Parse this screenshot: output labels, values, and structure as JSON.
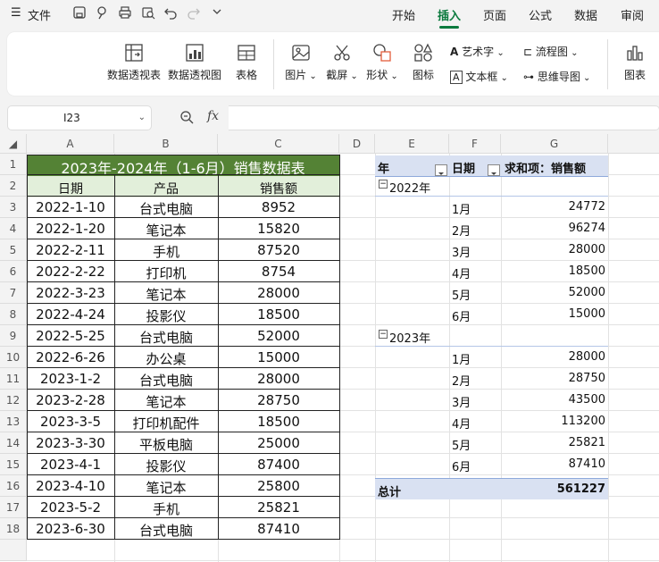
{
  "menubar": {
    "menu_icon": "☰",
    "file_label": "文件",
    "tabs": [
      "开始",
      "插入",
      "页面",
      "公式",
      "数据",
      "审阅"
    ],
    "active_tab": "插入"
  },
  "ribbon": {
    "pivot_table": "数据透视表",
    "pivot_chart": "数据透视图",
    "table": "表格",
    "picture": "图片",
    "screenshot": "截屏",
    "shape": "形状",
    "icon": "图标",
    "wordart": "艺术字",
    "textbox": "文本框",
    "flowchart": "流程图",
    "mindmap": "思维导图",
    "chart": "图表"
  },
  "formula": {
    "namebox": "I23",
    "fx": "fx",
    "value": ""
  },
  "columns": [
    "A",
    "B",
    "C",
    "D",
    "E",
    "F",
    "G"
  ],
  "rows": [
    "1",
    "2",
    "3",
    "4",
    "5",
    "6",
    "7",
    "8",
    "9",
    "10",
    "11",
    "12",
    "13",
    "14",
    "15",
    "16",
    "17",
    "18",
    ""
  ],
  "table": {
    "title": "2023年-2024年（1-6月）销售数据表",
    "headers": [
      "日期",
      "产品",
      "销售额"
    ],
    "rows": [
      [
        "2022-1-10",
        "台式电脑",
        "8952"
      ],
      [
        "2022-1-20",
        "笔记本",
        "15820"
      ],
      [
        "2022-2-11",
        "手机",
        "87520"
      ],
      [
        "2022-2-22",
        "打印机",
        "8754"
      ],
      [
        "2022-3-23",
        "笔记本",
        "28000"
      ],
      [
        "2022-4-24",
        "投影仪",
        "18500"
      ],
      [
        "2022-5-25",
        "台式电脑",
        "52000"
      ],
      [
        "2022-6-26",
        "办公桌",
        "15000"
      ],
      [
        "2023-1-2",
        "台式电脑",
        "28000"
      ],
      [
        "2023-2-28",
        "笔记本",
        "28750"
      ],
      [
        "2023-3-5",
        "打印机配件",
        "18500"
      ],
      [
        "2023-3-30",
        "平板电脑",
        "25000"
      ],
      [
        "2023-4-1",
        "投影仪",
        "87400"
      ],
      [
        "2023-4-10",
        "笔记本",
        "25800"
      ],
      [
        "2023-5-2",
        "手机",
        "25821"
      ],
      [
        "2023-6-30",
        "台式电脑",
        "87410"
      ]
    ]
  },
  "pivot": {
    "hdr_year": "年",
    "hdr_date": "日期",
    "hdr_sum": "求和项：销售额",
    "groups": [
      {
        "year": "2022年",
        "months": [
          [
            "1月",
            "24772"
          ],
          [
            "2月",
            "96274"
          ],
          [
            "3月",
            "28000"
          ],
          [
            "4月",
            "18500"
          ],
          [
            "5月",
            "52000"
          ],
          [
            "6月",
            "15000"
          ]
        ]
      },
      {
        "year": "2023年",
        "months": [
          [
            "1月",
            "28000"
          ],
          [
            "2月",
            "28750"
          ],
          [
            "3月",
            "43500"
          ],
          [
            "4月",
            "113200"
          ],
          [
            "5月",
            "25821"
          ],
          [
            "6月",
            "87410"
          ]
        ]
      }
    ],
    "total_label": "总计",
    "total_value": "561227"
  },
  "colors": {
    "title_bg": "#548235",
    "header_bg": "#e2efda",
    "pivot_header_bg": "#d9e1f2",
    "accent": "#0b7a3e"
  }
}
